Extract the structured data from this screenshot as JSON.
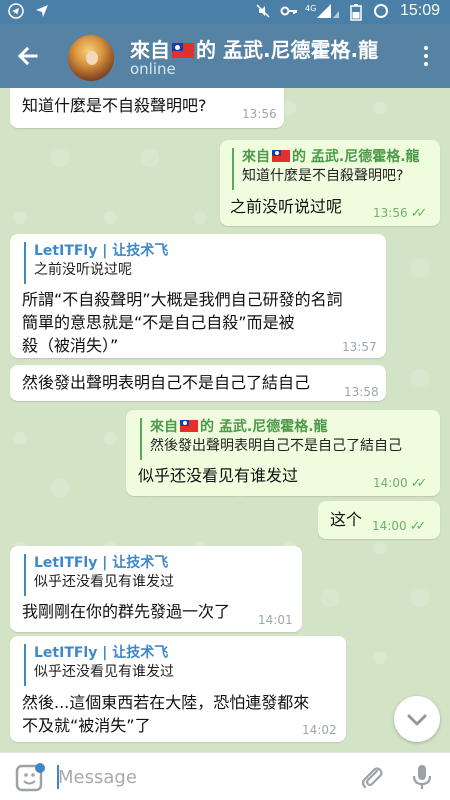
{
  "status_bar": {
    "time": "15:09",
    "network": "4G"
  },
  "header": {
    "title_prefix": "來自",
    "title_suffix": "的 孟武.尼德霍格.龍",
    "status": "online"
  },
  "messages": [
    {
      "dir": "in",
      "text": "知道什麼是不自殺聲明吧?",
      "time": "13:56"
    },
    {
      "dir": "out",
      "reply_name_prefix": "來自",
      "reply_name_suffix": "的 孟武.尼德霍格.龍",
      "reply_text": "知道什麼是不自殺聲明吧?",
      "text": "之前没听说过呢",
      "time": "13:56"
    },
    {
      "dir": "in",
      "reply_name": "LetITFly | 让技术飞",
      "reply_text": "之前没听说过呢",
      "line1": "所謂“不自殺聲明”大概是我們自己研發的名詞",
      "line2": "簡單的意思就是“不是自己自殺”而是被",
      "line3": "殺（被消失）”",
      "time": "13:57"
    },
    {
      "dir": "in",
      "text": "然後發出聲明表明自己不是自己了結自己",
      "time": "13:58"
    },
    {
      "dir": "out",
      "reply_name_prefix": "來自",
      "reply_name_suffix": "的 孟武.尼德霍格.龍",
      "reply_text": "然後發出聲明表明自己不是自己了結自己",
      "text": "似乎还没看见有谁发过",
      "time": "14:00"
    },
    {
      "dir": "out",
      "text": "这个",
      "time": "14:00"
    },
    {
      "dir": "in",
      "reply_name": "LetITFly | 让技术飞",
      "reply_text": "似乎还没看见有谁发过",
      "text": "我剛剛在你的群先發過一次了",
      "time": "14:01"
    },
    {
      "dir": "in",
      "reply_name": "LetITFly | 让技术飞",
      "reply_text": "似乎还没看见有谁发过",
      "line1": "然後...這個東西若在大陸，恐怕連發都來",
      "line2": "不及就“被消失”了",
      "time": "14:02"
    }
  ],
  "input": {
    "placeholder": "Message"
  },
  "colors": {
    "action_bar": "#5682a3",
    "status_bar": "#4a7fa8",
    "outgoing_bubble": "#effdde",
    "incoming_bubble": "#ffffff",
    "link_blue": "#3f88c8",
    "reply_green": "#4e9a4b"
  },
  "icons": [
    "back-arrow-icon",
    "more-vert-icon",
    "sticker-icon",
    "paperclip-icon",
    "mic-icon",
    "chevron-down-icon",
    "telegram-icon",
    "location-arrow-icon",
    "mute-icon",
    "key-icon",
    "signal-icon",
    "battery-icon",
    "sync-icon",
    "read-checks-icon"
  ]
}
